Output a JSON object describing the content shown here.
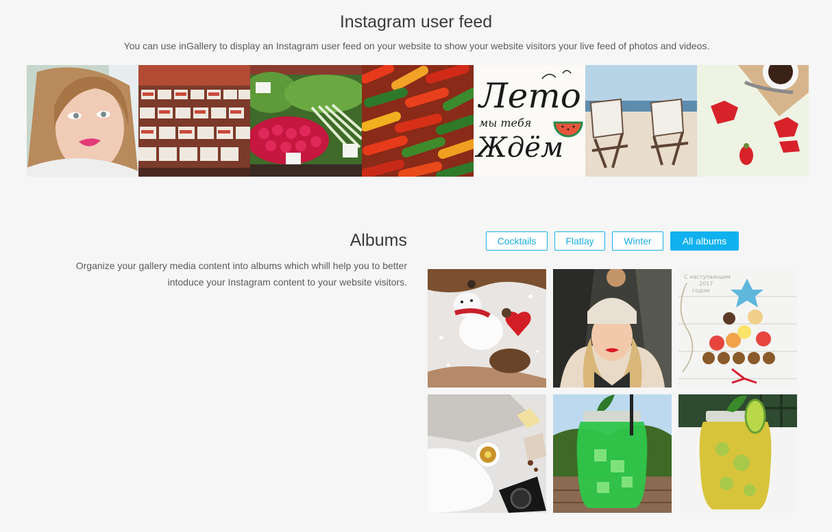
{
  "feed": {
    "title": "Instagram user feed",
    "subtitle": "You can use inGallery to display an Instagram user feed on your website to show your website visitors your live feed of photos and videos.",
    "photos": [
      {
        "name": "feed-photo-selfie"
      },
      {
        "name": "feed-photo-market-stall"
      },
      {
        "name": "feed-photo-radishes"
      },
      {
        "name": "feed-photo-peppers"
      },
      {
        "name": "feed-photo-lettering",
        "text_line1": "Лето",
        "text_line2": "мы тебя",
        "text_line3": "Ждём"
      },
      {
        "name": "feed-photo-beach-chairs"
      },
      {
        "name": "feed-photo-strawberries"
      }
    ]
  },
  "albums": {
    "title": "Albums",
    "description": "Organize your gallery media content into albums which whill help you to better intoduce your Instagram content to your website visitors.",
    "filters": [
      {
        "label": "Cocktails",
        "active": false
      },
      {
        "label": "Flatlay",
        "active": false
      },
      {
        "label": "Winter",
        "active": false
      },
      {
        "label": "All albums",
        "active": true
      }
    ],
    "photos": [
      {
        "name": "album-photo-snowman"
      },
      {
        "name": "album-photo-winter-portrait"
      },
      {
        "name": "album-photo-cookies-tree",
        "caption_line1": "С наступающим",
        "caption_line2": "2017",
        "caption_line3": "годом"
      },
      {
        "name": "album-photo-tea-flatlay"
      },
      {
        "name": "album-photo-green-cocktail"
      },
      {
        "name": "album-photo-lime-cocktail"
      }
    ]
  },
  "colors": {
    "accent": "#18aee6",
    "active_bg": "#0fb1ef",
    "page_bg": "#f6f6f6"
  }
}
